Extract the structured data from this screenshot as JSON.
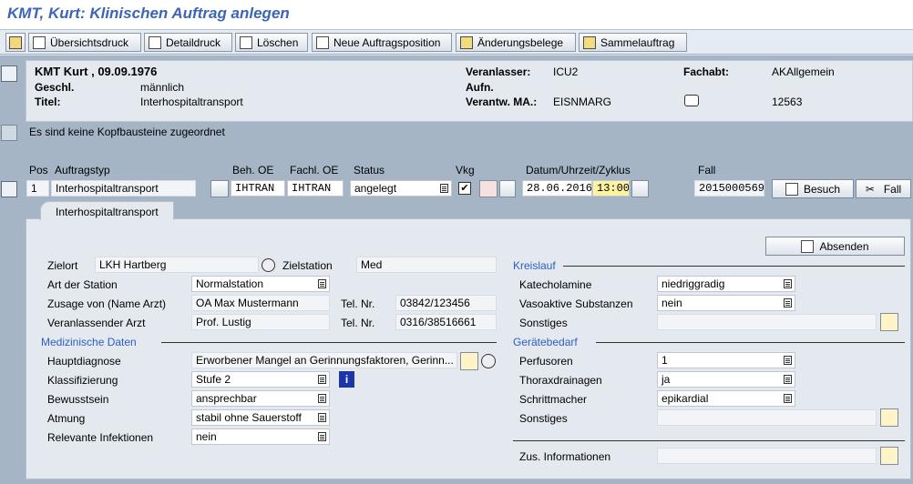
{
  "window": {
    "title": "KMT, Kurt: Klinischen Auftrag anlegen"
  },
  "toolbar": {
    "overview_print": "Übersichtsdruck",
    "detail_print": "Detaildruck",
    "delete": "Löschen",
    "new_position": "Neue Auftragsposition",
    "change_docs": "Änderungsbelege",
    "collective_order": "Sammelauftrag"
  },
  "patient": {
    "name": "KMT Kurt , 09.09.1976",
    "gender_label": "Geschl.",
    "gender": "männlich",
    "title_label": "Titel:",
    "title": "Interhospitaltransport",
    "requester_label": "Veranlasser:",
    "requester": "ICU2",
    "admission_label": "Aufn.",
    "responsible_label": "Verantw. MA.:",
    "responsible": "EISNMARG",
    "dept_label": "Fachabt:",
    "dept": "AKAllgemein",
    "phone": "12563"
  },
  "header_note": "Es sind keine Kopfbausteine zugeordnet",
  "order_row": {
    "col_pos": "Pos",
    "col_type": "Auftragstyp",
    "col_beh_oe": "Beh. OE",
    "col_fach_oe": "Fachl. OE",
    "col_status": "Status",
    "col_vkg": "Vkg",
    "col_datetime": "Datum/Uhrzeit/Zyklus",
    "col_case": "Fall",
    "pos": "1",
    "type": "Interhospitaltransport",
    "beh_oe": "IHTRAN",
    "fach_oe": "IHTRAN",
    "status": "angelegt",
    "date": "28.06.2016",
    "time": "13:00",
    "case": "2015000569",
    "visit_btn": "Besuch",
    "case_btn": "Fall"
  },
  "tab": {
    "label": "Interhospitaltransport"
  },
  "send_btn": "Absenden",
  "form": {
    "zielort_label": "Zielort",
    "zielort": "LKH Hartberg",
    "zielstation_label": "Zielstation",
    "zielstation": "Med",
    "art_label": "Art der Station",
    "art": "Normalstation",
    "zusage_label": "Zusage von (Name Arzt)",
    "zusage": "OA Max Mustermann",
    "tel_label": "Tel. Nr.",
    "zusage_tel": "03842/123456",
    "veranl_label": "Veranlassender Arzt",
    "veranl": "Prof. Lustig",
    "veranl_tel": "0316/38516661",
    "med_section": "Medizinische Daten",
    "haupt_label": "Hauptdiagnose",
    "haupt": "Erworbener Mangel an Gerinnungsfaktoren, Gerinn...",
    "klass_label": "Klassifizierung",
    "klass": "Stufe 2",
    "bew_label": "Bewusstsein",
    "bew": "ansprechbar",
    "atm_label": "Atmung",
    "atm": "stabil ohne Sauerstoff",
    "inf_label": "Relevante Infektionen",
    "inf": "nein",
    "kreis_section": "Kreislauf",
    "kat_label": "Katecholamine",
    "kat": "niedriggradig",
    "vaso_label": "Vasoaktive Substanzen",
    "vaso": "nein",
    "sonst1_label": "Sonstiges",
    "geraet_section": "Gerätebedarf",
    "perf_label": "Perfusoren",
    "perf": "1",
    "thorax_label": "Thoraxdrainagen",
    "thorax": "ja",
    "schritt_label": "Schrittmacher",
    "schritt": "epikardial",
    "sonst2_label": "Sonstiges",
    "zus_label": "Zus. Informationen"
  }
}
